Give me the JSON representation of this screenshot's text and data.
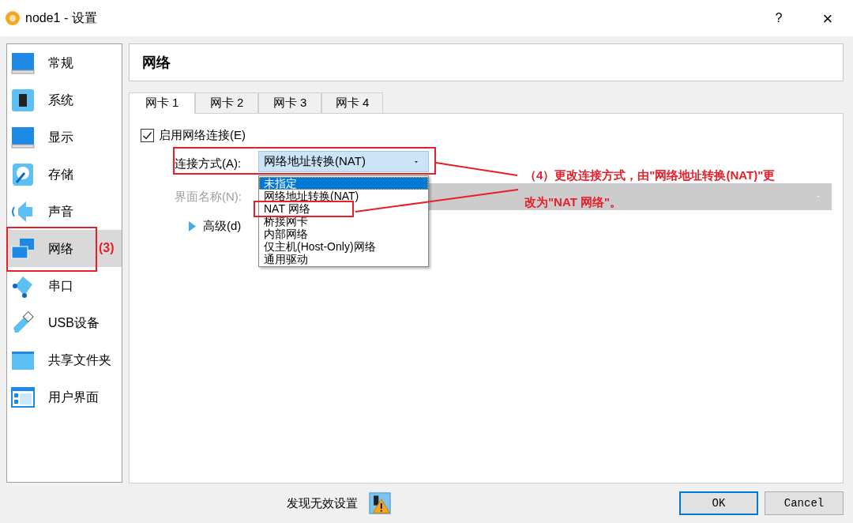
{
  "window": {
    "title": "node1 - 设置",
    "help": "?",
    "close": "×"
  },
  "sidebar": {
    "items": [
      {
        "label": "常规",
        "selected": false
      },
      {
        "label": "系统",
        "selected": false
      },
      {
        "label": "显示",
        "selected": false
      },
      {
        "label": "存储",
        "selected": false
      },
      {
        "label": "声音",
        "selected": false
      },
      {
        "label": "网络",
        "selected": true
      },
      {
        "label": "串口",
        "selected": false
      },
      {
        "label": "USB设备",
        "selected": false
      },
      {
        "label": "共享文件夹",
        "selected": false
      },
      {
        "label": "用户界面",
        "selected": false
      }
    ]
  },
  "page": {
    "title": "网络"
  },
  "tabs": [
    {
      "label": "网卡 1",
      "selected": true
    },
    {
      "label": "网卡 2",
      "selected": false
    },
    {
      "label": "网卡 3",
      "selected": false
    },
    {
      "label": "网卡 4",
      "selected": false
    }
  ],
  "enable_network": {
    "label": "启用网络连接(E)",
    "checked": true
  },
  "attached_to": {
    "label": "连接方式(A):",
    "value": "网络地址转换(NAT)",
    "expanded": true,
    "options": [
      {
        "label": "未指定",
        "highlighted": true
      },
      {
        "label": "网络地址转换(NAT)",
        "highlighted": false
      },
      {
        "label": "NAT 网络",
        "highlighted": false
      },
      {
        "label": "桥接网卡",
        "highlighted": false
      },
      {
        "label": "内部网络",
        "highlighted": false
      },
      {
        "label": "仅主机(Host-Only)网络",
        "highlighted": false
      },
      {
        "label": "通用驱动",
        "highlighted": false
      }
    ]
  },
  "interface_name": {
    "label": "界面名称(N):",
    "disabled": true
  },
  "advanced": {
    "label": "高级(d)",
    "expanded": false
  },
  "status": {
    "text": "发现无效设置"
  },
  "buttons": [
    {
      "label": "OK",
      "default": true
    },
    {
      "label": "Cancel",
      "default": false
    }
  ],
  "annotations": [
    {
      "lines": [
        "(3)"
      ]
    },
    {
      "lines": [
        "（4）更改连接方式，由\"网络地址转换(NAT)\"更",
        "改为\"NAT 网络\"。"
      ]
    }
  ]
}
